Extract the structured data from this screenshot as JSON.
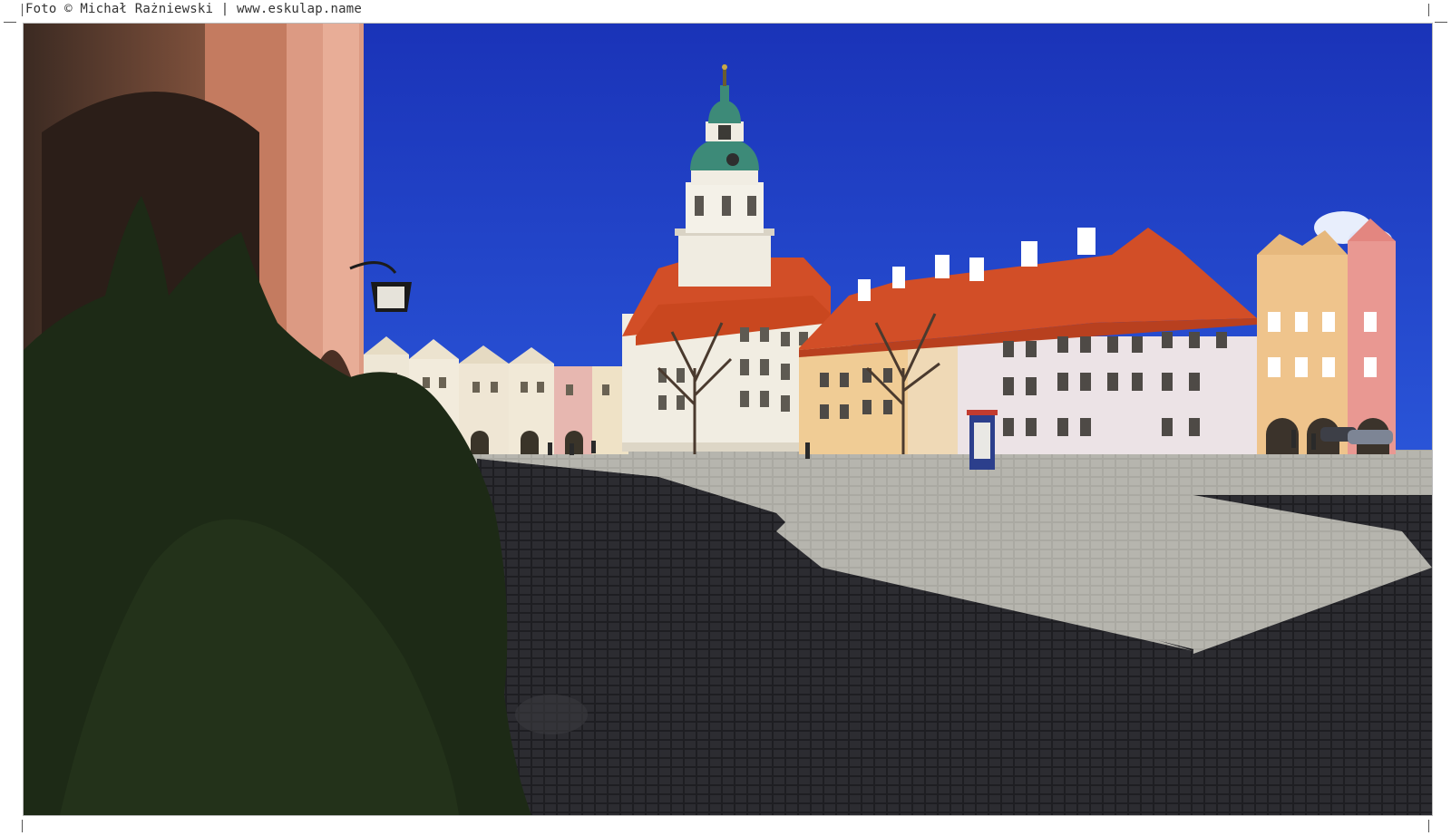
{
  "caption": {
    "credit": "Foto © Michał Rażniewski | www.eskulap.name"
  },
  "photo": {
    "subject": "town-square-with-town-hall-tower",
    "colors": {
      "sky": "#1f3fc9",
      "plaza_light": "#a9a9a2",
      "plaza_shadow": "#2a2a2e",
      "roof": "#d2502a",
      "facade_light": "#f1ede2",
      "tower_dome": "#3d8a78",
      "bush": "#1d2a16"
    }
  }
}
